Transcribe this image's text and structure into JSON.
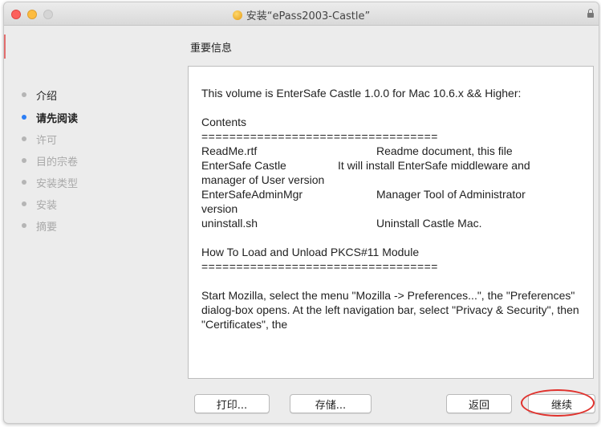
{
  "window": {
    "title": "安装“ePass2003-Castle”"
  },
  "sidebar": {
    "items": [
      {
        "label": "介绍",
        "state": "done"
      },
      {
        "label": "请先阅读",
        "state": "active"
      },
      {
        "label": "许可",
        "state": "disabled"
      },
      {
        "label": "目的宗卷",
        "state": "disabled"
      },
      {
        "label": "安装类型",
        "state": "disabled"
      },
      {
        "label": "安装",
        "state": "disabled"
      },
      {
        "label": "摘要",
        "state": "disabled"
      }
    ]
  },
  "main": {
    "section_title": "重要信息",
    "readme": {
      "intro": "This volume is EnterSafe Castle 1.0.0 for Mac 10.6.x && Higher:",
      "contents_title": "Contents",
      "separator": "==================================",
      "files": [
        {
          "name": "ReadMe.rtf",
          "desc": "Readme document, this file"
        },
        {
          "name": "EnterSafe Castle",
          "desc": "It will install EnterSafe middleware and"
        },
        {
          "name": "manager of User version",
          "desc": ""
        },
        {
          "name": "EnterSafeAdminMgr",
          "desc": "Manager Tool of Administrator"
        },
        {
          "name": "version",
          "desc": ""
        },
        {
          "name": "uninstall.sh",
          "desc": "Uninstall Castle Mac."
        }
      ],
      "pkcs_title": "How To Load and Unload PKCS#11 Module",
      "pkcs_separator": "==================================",
      "paragraph": "Start Mozilla, select the menu \"Mozilla -> Preferences...\", the \"Preferences\" dialog-box opens. At the left navigation bar, select \"Privacy & Security\", then \"Certificates\", the"
    }
  },
  "buttons": {
    "print": "打印...",
    "save": "存储...",
    "back": "返回",
    "continue": "继续"
  },
  "colors": {
    "active_dot": "#2c7ef5",
    "highlight": "#e0322d"
  }
}
